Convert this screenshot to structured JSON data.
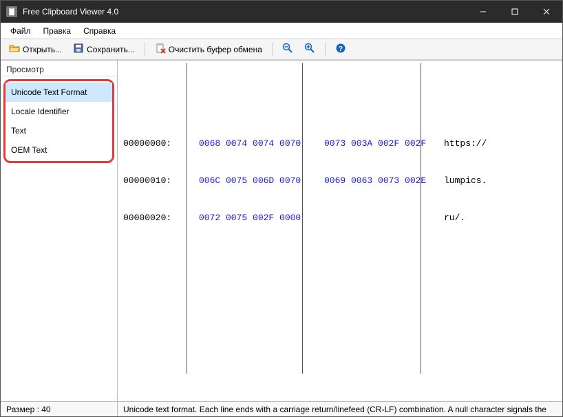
{
  "window": {
    "title": "Free Clipboard Viewer 4.0"
  },
  "menu": {
    "items": [
      "Файл",
      "Правка",
      "Справка"
    ]
  },
  "toolbar": {
    "open": "Открыть...",
    "save": "Сохранить...",
    "clear": "Очистить буфер обмена"
  },
  "sidebar": {
    "header": "Просмотр",
    "items": [
      {
        "label": "Unicode Text Format",
        "selected": true
      },
      {
        "label": "Locale Identifier",
        "selected": false
      },
      {
        "label": "Text",
        "selected": false
      },
      {
        "label": "OEM Text",
        "selected": false
      }
    ]
  },
  "hex": {
    "rows": [
      {
        "offset": "00000000:",
        "g1": "0068 0074 0074 0070",
        "g2": "0073 003A 002F 002F",
        "ascii": "https://"
      },
      {
        "offset": "00000010:",
        "g1": "006C 0075 006D 0070",
        "g2": "0069 0063 0073 002E",
        "ascii": "lumpics."
      },
      {
        "offset": "00000020:",
        "g1": "0072 0075 002F 0000",
        "g2": "",
        "ascii": "ru/."
      }
    ]
  },
  "status": {
    "size": "Размер : 40",
    "desc": "Unicode text format. Each line ends with a carriage return/linefeed (CR-LF) combination. A null character signals the"
  }
}
